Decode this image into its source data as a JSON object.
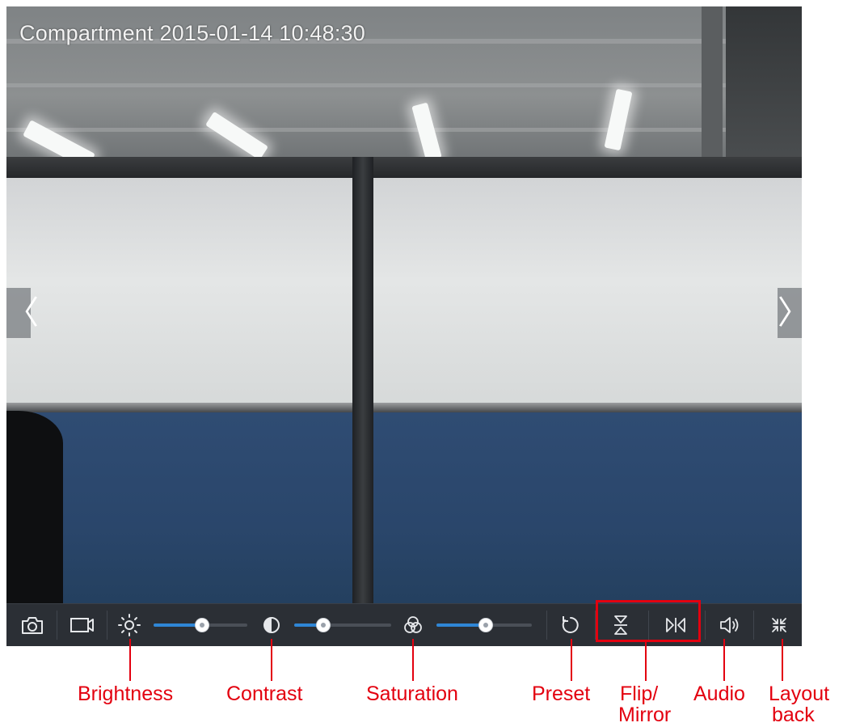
{
  "camera": {
    "osd_title": "Compartment 2015-01-14 10:48:30"
  },
  "navigation": {
    "prev_glyph": "〈",
    "next_glyph": "〉"
  },
  "toolbar": {
    "buttons": [
      {
        "name": "snapshot",
        "icon": "camera-icon"
      },
      {
        "name": "record",
        "icon": "video-camera-icon"
      },
      {
        "name": "brightness",
        "icon": "sun-icon"
      },
      {
        "name": "contrast",
        "icon": "half-circle-icon"
      },
      {
        "name": "saturation",
        "icon": "rgb-circles-icon"
      },
      {
        "name": "preset",
        "icon": "refresh-icon"
      },
      {
        "name": "flip",
        "icon": "flip-vertical-icon"
      },
      {
        "name": "mirror",
        "icon": "mirror-horizontal-icon"
      },
      {
        "name": "audio",
        "icon": "speaker-icon"
      },
      {
        "name": "layout-back",
        "icon": "collapse-arrows-icon"
      }
    ],
    "sliders": {
      "brightness": 0.52,
      "contrast": 0.3,
      "saturation": 0.52
    }
  },
  "annotations": {
    "brightness": "Brightness",
    "contrast": "Contrast",
    "saturation": "Saturation",
    "preset": "Preset",
    "flip_mirror_1": "Flip/",
    "flip_mirror_2": "Mirror",
    "audio": "Audio",
    "layout_back_1": "Layout",
    "layout_back_2": "back"
  },
  "colors": {
    "annotation": "#e3000f",
    "slider_fill": "#2f86d6",
    "toolbar_bg": "#2b2f35"
  }
}
